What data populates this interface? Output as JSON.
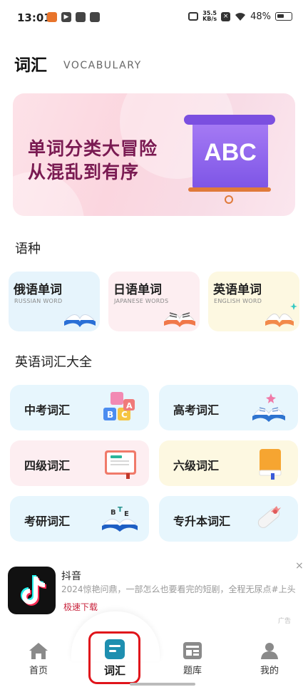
{
  "status_bar": {
    "time": "13:01",
    "speed_value": "35.5",
    "speed_unit": "KB/s",
    "battery": "48%"
  },
  "header": {
    "title": "词汇",
    "subtitle": "VOCABULARY"
  },
  "banner": {
    "line1": "单词分类大冒险",
    "line2": "从混乱到有序",
    "art_text": "ABC"
  },
  "languages": {
    "title": "语种",
    "items": [
      {
        "title": "俄语单词",
        "subtitle": "RUSSIAN WORD"
      },
      {
        "title": "日语单词",
        "subtitle": "JAPANESE WORDS"
      },
      {
        "title": "英语单词",
        "subtitle": "ENGLISH WORD"
      }
    ]
  },
  "english_vocab": {
    "title": "英语词汇大全",
    "items": [
      {
        "label": "中考词汇",
        "icon": "abc-blocks-icon"
      },
      {
        "label": "高考词汇",
        "icon": "open-book-star-icon"
      },
      {
        "label": "四级词汇",
        "icon": "notebook-icon"
      },
      {
        "label": "六级词汇",
        "icon": "closed-book-icon"
      },
      {
        "label": "考研词汇",
        "icon": "letters-book-icon"
      },
      {
        "label": "专升本词汇",
        "icon": "diploma-scroll-icon"
      }
    ]
  },
  "ad": {
    "app_name": "抖音",
    "description": "2024惊艳问鼎，一部怎么也要看完的短剧，全程无尿点#上头",
    "cta": "极速下载",
    "tag": "广告",
    "close": "×"
  },
  "bottom_nav": {
    "items": [
      {
        "label": "首页",
        "icon": "home-icon"
      },
      {
        "label": "词汇",
        "icon": "vocabulary-icon"
      },
      {
        "label": "题库",
        "icon": "question-bank-icon"
      },
      {
        "label": "我的",
        "icon": "profile-icon"
      }
    ],
    "active": "词汇"
  },
  "colors": {
    "banner_text": "#7a1a52",
    "active_nav": "#1e8fb0",
    "highlight_box": "#e0141b",
    "ad_cta": "#c8233c"
  }
}
